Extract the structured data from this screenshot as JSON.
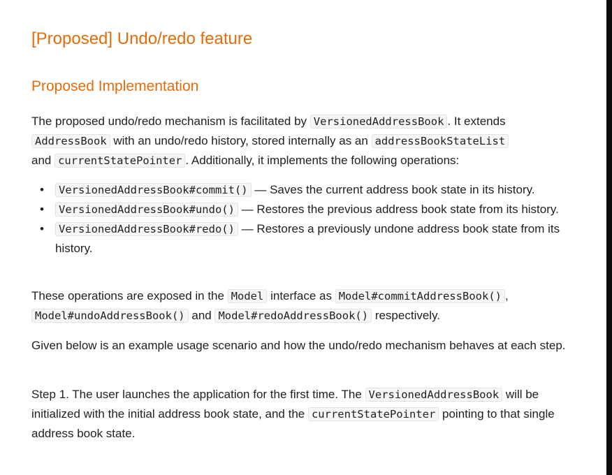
{
  "title": "[Proposed] Undo/redo feature",
  "subtitle": "Proposed Implementation",
  "para1": {
    "t1": "The proposed undo/redo mechanism is facilitated by ",
    "c1": "VersionedAddressBook",
    "t2": ". It extends ",
    "c2": "AddressBook",
    "t3": " with an undo/redo history, stored internally as an ",
    "c3": "addressBookStateList",
    "t4": " and ",
    "c4": "currentStatePointer",
    "t5": ". Additionally, it implements the following operations:"
  },
  "operations": [
    {
      "code": "VersionedAddressBook#commit()",
      "text": " — Saves the current address book state in its history."
    },
    {
      "code": "VersionedAddressBook#undo()",
      "text": " — Restores the previous address book state from its history."
    },
    {
      "code": "VersionedAddressBook#redo()",
      "text": " — Restores a previously undone address book state from its history."
    }
  ],
  "para2": {
    "t1": "These operations are exposed in the ",
    "c1": "Model",
    "t2": " interface as ",
    "c2": "Model#commitAddressBook()",
    "t3": ", ",
    "c3": "Model#undoAddressBook()",
    "t4": " and ",
    "c4": "Model#redoAddressBook()",
    "t5": " respectively."
  },
  "para3": "Given below is an example usage scenario and how the undo/redo mechanism behaves at each step.",
  "para4": {
    "t1": "Step 1. The user launches the application for the first time. The ",
    "c1": "VersionedAddressBook",
    "t2": " will be initialized with the initial address book state, and the ",
    "c2": "currentStatePointer",
    "t3": " pointing to that single address book state."
  },
  "bullet_char": "•"
}
